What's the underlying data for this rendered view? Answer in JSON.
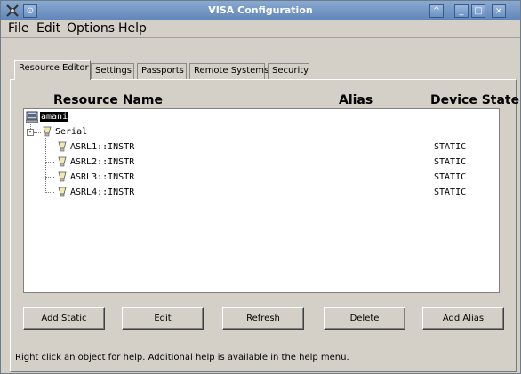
{
  "window": {
    "title": "VISA Configuration"
  },
  "menu": [
    "File",
    "Edit",
    "Options",
    "Help"
  ],
  "tabs": [
    {
      "label": "Resource Editor",
      "active": true
    },
    {
      "label": "Settings",
      "active": false
    },
    {
      "label": "Passports",
      "active": false
    },
    {
      "label": "Remote Systems",
      "active": false
    },
    {
      "label": "Security",
      "active": false
    }
  ],
  "columns": {
    "resource_name": "Resource Name",
    "alias": "Alias",
    "device_state": "Device State"
  },
  "tree": {
    "root": {
      "label": "amani",
      "selected": true,
      "icon": "computer-icon"
    },
    "group": {
      "label": "Serial",
      "expanded": true,
      "icon": "serial-icon"
    },
    "resources": [
      {
        "name": "ASRL1::INSTR",
        "alias": "",
        "state": "STATIC"
      },
      {
        "name": "ASRL2::INSTR",
        "alias": "",
        "state": "STATIC"
      },
      {
        "name": "ASRL3::INSTR",
        "alias": "",
        "state": "STATIC"
      },
      {
        "name": "ASRL4::INSTR",
        "alias": "",
        "state": "STATIC"
      }
    ]
  },
  "buttons": {
    "add_static": "Add Static",
    "edit": "Edit",
    "refresh": "Refresh",
    "delete": "Delete",
    "add_alias": "Add Alias"
  },
  "status": "Right click an object for help.  Additional help is available in the help menu.",
  "colors": {
    "titlebar": "#6f93c6",
    "selection": "#000000"
  }
}
